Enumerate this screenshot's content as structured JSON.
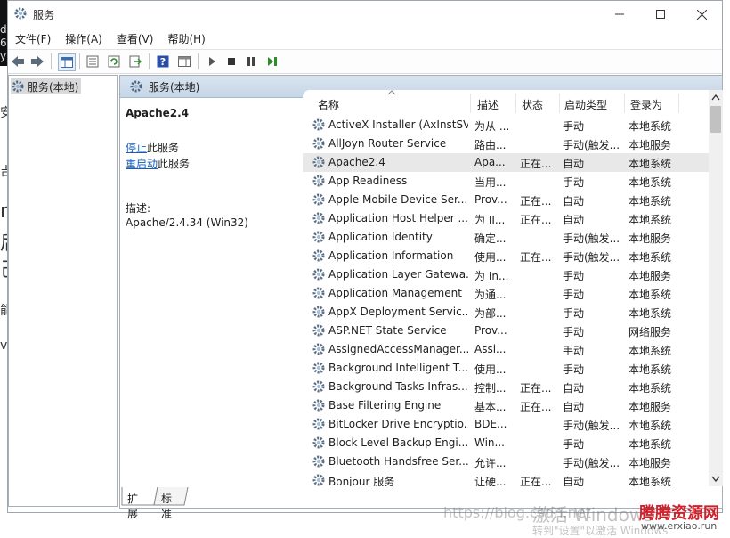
{
  "window": {
    "title": "服务",
    "min_icon": "minimize-icon",
    "max_icon": "maximize-icon",
    "close_icon": "close-icon"
  },
  "menu": [
    "文件(F)",
    "操作(A)",
    "查看(V)",
    "帮助(H)"
  ],
  "tree": {
    "item": "服务(本地)"
  },
  "pane": {
    "header": "服务(本地)"
  },
  "details": {
    "service_name": "Apache2.4",
    "stop_link": "停止",
    "stop_suffix": "此服务",
    "restart_link": "重启动",
    "restart_suffix": "此服务",
    "desc_label": "描述:",
    "desc_value": "Apache/2.4.34 (Win32)"
  },
  "columns": [
    "名称",
    "描述",
    "状态",
    "启动类型",
    "登录为"
  ],
  "services": [
    {
      "name": "ActiveX Installer (AxInstSV)",
      "desc": "为从 ...",
      "status": "",
      "startup": "手动",
      "logon": "本地系统"
    },
    {
      "name": "AllJoyn Router Service",
      "desc": "路由...",
      "status": "",
      "startup": "手动(触发...",
      "logon": "本地服务"
    },
    {
      "name": "Apache2.4",
      "desc": "Apa...",
      "status": "正在...",
      "startup": "自动",
      "logon": "本地系统"
    },
    {
      "name": "App Readiness",
      "desc": "当用...",
      "status": "",
      "startup": "手动",
      "logon": "本地系统"
    },
    {
      "name": "Apple Mobile Device Ser...",
      "desc": "Prov...",
      "status": "正在...",
      "startup": "自动",
      "logon": "本地系统"
    },
    {
      "name": "Application Host Helper ...",
      "desc": "为 II...",
      "status": "正在...",
      "startup": "自动",
      "logon": "本地系统"
    },
    {
      "name": "Application Identity",
      "desc": "确定...",
      "status": "",
      "startup": "手动(触发...",
      "logon": "本地服务"
    },
    {
      "name": "Application Information",
      "desc": "使用...",
      "status": "正在...",
      "startup": "手动(触发...",
      "logon": "本地系统"
    },
    {
      "name": "Application Layer Gatewa...",
      "desc": "为 In...",
      "status": "",
      "startup": "手动",
      "logon": "本地服务"
    },
    {
      "name": "Application Management",
      "desc": "为通...",
      "status": "",
      "startup": "手动",
      "logon": "本地系统"
    },
    {
      "name": "AppX Deployment Servic...",
      "desc": "为部...",
      "status": "",
      "startup": "手动",
      "logon": "本地系统"
    },
    {
      "name": "ASP.NET State Service",
      "desc": "Prov...",
      "status": "",
      "startup": "手动",
      "logon": "网络服务"
    },
    {
      "name": "AssignedAccessManager...",
      "desc": "Assi...",
      "status": "",
      "startup": "手动",
      "logon": "本地系统"
    },
    {
      "name": "Background Intelligent T...",
      "desc": "使用...",
      "status": "",
      "startup": "手动",
      "logon": "本地系统"
    },
    {
      "name": "Background Tasks Infras...",
      "desc": "控制...",
      "status": "正在...",
      "startup": "自动",
      "logon": "本地系统"
    },
    {
      "name": "Base Filtering Engine",
      "desc": "基本...",
      "status": "正在...",
      "startup": "自动",
      "logon": "本地服务"
    },
    {
      "name": "BitLocker Drive Encryptio...",
      "desc": "BDE...",
      "status": "",
      "startup": "手动(触发...",
      "logon": "本地系统"
    },
    {
      "name": "Block Level Backup Engi...",
      "desc": "Win...",
      "status": "",
      "startup": "手动",
      "logon": "本地系统"
    },
    {
      "name": "Bluetooth Handsfree Ser...",
      "desc": "允许...",
      "status": "",
      "startup": "手动(触发...",
      "logon": "本地服务"
    },
    {
      "name": "Bonjour 服务",
      "desc": "让硬...",
      "status": "正在...",
      "startup": "自动",
      "logon": "本地系统"
    }
  ],
  "tabs": [
    "扩展",
    "标准"
  ],
  "background_text": {
    "left_chars": [
      "d",
      "6",
      "y",
      "安",
      "吉",
      "n",
      "后",
      "己",
      "能",
      "vi"
    ]
  },
  "watermark": {
    "url": "https://blog.csdn.net",
    "activate": "激活 Windows",
    "activate2": "转到\"设置\"以激活 Windows",
    "brand": "腾腾资源网",
    "brand_url": "www.erxiao.run"
  },
  "colors": {
    "selected_row": "#e8e8e8",
    "link": "#1a5fb4",
    "header_bar": "#c5d6e7"
  }
}
